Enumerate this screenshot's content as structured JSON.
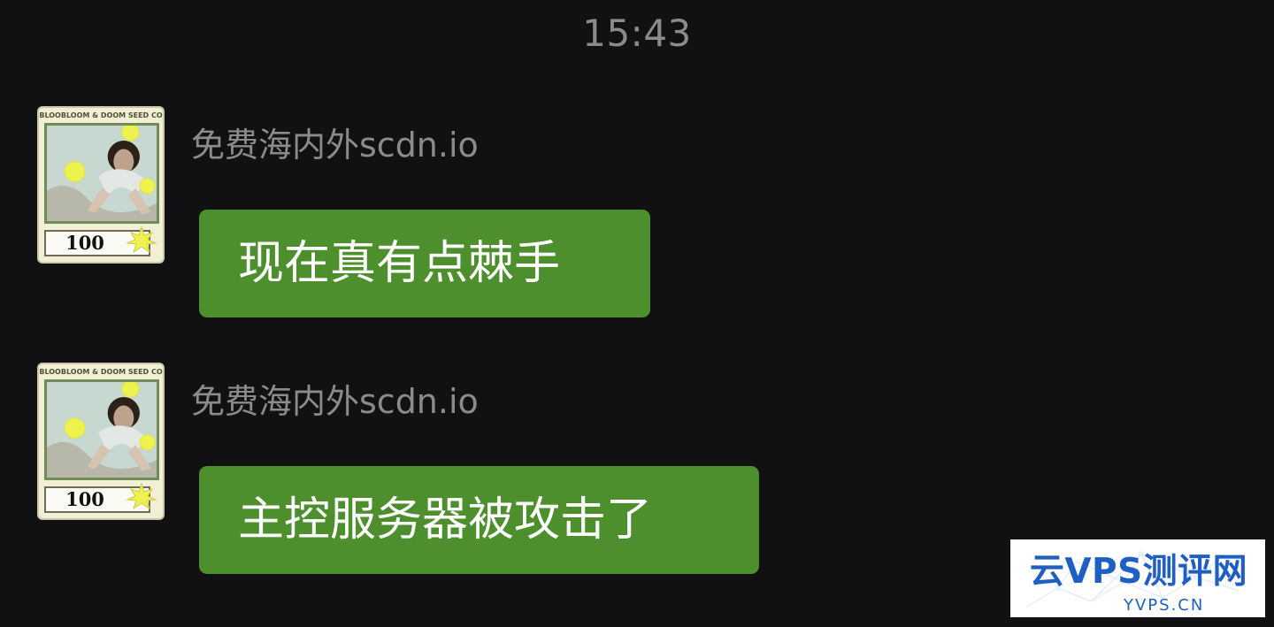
{
  "timestamp": "15:43",
  "messages": [
    {
      "sender": "免费海内外scdn.io",
      "text": "现在真有点棘手",
      "avatar": {
        "title": "BLOOBLOOM & DOOM SEED CO",
        "value": "100",
        "icon": "trading-card-avatar-icon"
      }
    },
    {
      "sender": "免费海内外scdn.io",
      "text": "主控服务器被攻击了",
      "avatar": {
        "title": "BLOOBLOOM & DOOM SEED CO",
        "value": "100",
        "icon": "trading-card-avatar-icon"
      }
    }
  ],
  "watermark": {
    "title": "云VPS测评网",
    "subtitle": "YVPS.CN"
  },
  "colors": {
    "background": "#111113",
    "timestamp": "#8b8b8d",
    "sender": "#8b8b8d",
    "bubble": "#4d8e2d",
    "bubble_text": "#ffffff",
    "watermark": "#1f5fc4"
  }
}
